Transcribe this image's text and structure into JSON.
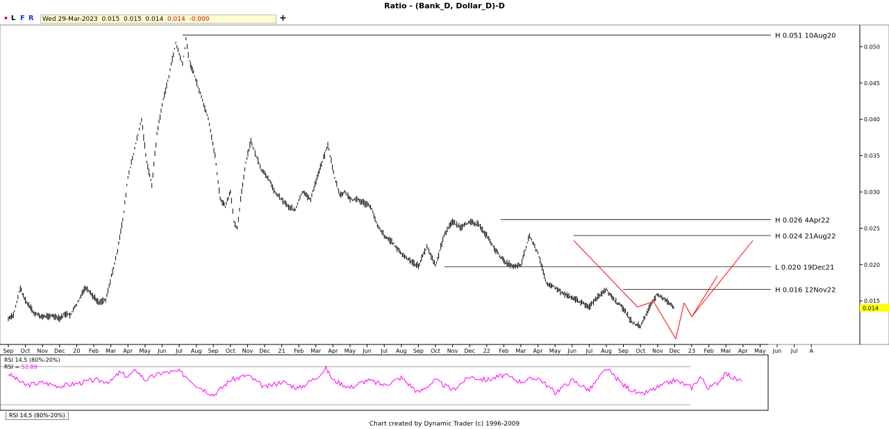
{
  "app": {
    "title": "Ratio - (Bank_D, Dollar_D)-D",
    "footer": "Chart created by Dynamic Trader  (c) 1996-2009",
    "indicator_tab": "RSI 14,5 (80%-20%)"
  },
  "toolbar": {
    "dot": "•",
    "items": [
      "L",
      "F",
      "R"
    ],
    "info_line": "Wed 29-Mar-2023  0.015  0.015  0.014  0.014  -0.000",
    "info_main": "Wed 29-Mar-2023  0.015  0.015  0.014  ",
    "info_close": "0.014  -0.000",
    "plus": "+"
  },
  "colors": {
    "price": "#000000",
    "pattern": "#ff0000",
    "rsi": "#ff00ff",
    "last_price_box": "#ffff00"
  },
  "chart_data": [
    {
      "type": "line",
      "title": "Ratio - (Bank_D, Dollar_D)-D",
      "ylim": [
        0.009,
        0.053
      ],
      "y_ticks": [
        "0.050",
        "0.045",
        "0.040",
        "0.035",
        "0.030",
        "0.025",
        "0.020",
        "0.015",
        "0.014"
      ],
      "x_ticks": [
        "Sep",
        "Oct",
        "Nov",
        "Dec",
        "20",
        "Feb",
        "Mar",
        "Apr",
        "May",
        "Jun",
        "Jul",
        "Aug",
        "Sep",
        "Oct",
        "Nov",
        "Dec",
        "21",
        "Feb",
        "Mar",
        "Apr",
        "May",
        "Jun",
        "Jul",
        "Aug",
        "Sep",
        "Oct",
        "Nov",
        "Dec",
        "22",
        "Feb",
        "Mar",
        "Apr",
        "May",
        "Jun",
        "Jul",
        "Aug",
        "Sep",
        "Oct",
        "Nov",
        "Dec",
        "23",
        "Feb",
        "Mar",
        "Apr",
        "May",
        "Jun",
        "Jul",
        "A"
      ],
      "last_price": 0.014,
      "series": [
        {
          "x_month_index": [
            0,
            0.3,
            0.7,
            1.0,
            1.5,
            2.0,
            2.5,
            3.0,
            3.3,
            3.6,
            4.0,
            4.5,
            5.0,
            5.3,
            5.7,
            6.1,
            6.4,
            6.7,
            7.0,
            7.4,
            7.8,
            8.1,
            8.4,
            8.7,
            9.0,
            9.4,
            9.8,
            10.2,
            10.4,
            10.6,
            10.9,
            11.3,
            11.7,
            12.1,
            12.4,
            12.7,
            13.0,
            13.2,
            13.4,
            13.6,
            13.9,
            14.2,
            14.5,
            14.8,
            15.2,
            15.6,
            16.0,
            16.4,
            16.8,
            17.2,
            17.7,
            18.2,
            18.7,
            19.1,
            19.4,
            19.7,
            20.0,
            20.4,
            20.8,
            21.2,
            21.6,
            22.0,
            22.5,
            23.0,
            23.5,
            24.0,
            24.5,
            25.0,
            25.5,
            26.0,
            26.5,
            27.0,
            27.5,
            28.0,
            28.5,
            29.0,
            29.5,
            30.0,
            30.5,
            31.0,
            31.5,
            32.0,
            32.5,
            33.0,
            33.5,
            34.0,
            34.5,
            35.0,
            35.5,
            36.0,
            36.5,
            37.0,
            37.5,
            38.0,
            38.5,
            39.0,
            39.4,
            39.8,
            40.2,
            40.5,
            40.9,
            41.3,
            41.6,
            41.9,
            42.1,
            42.4,
            42.8
          ],
          "values": [
            0.0125,
            0.013,
            0.0168,
            0.015,
            0.0133,
            0.0128,
            0.013,
            0.0125,
            0.0132,
            0.013,
            0.0145,
            0.0168,
            0.0155,
            0.0148,
            0.0152,
            0.019,
            0.022,
            0.0262,
            0.032,
            0.036,
            0.04,
            0.034,
            0.031,
            0.038,
            0.042,
            0.046,
            0.0505,
            0.0475,
            0.051,
            0.048,
            0.046,
            0.043,
            0.04,
            0.035,
            0.029,
            0.028,
            0.03,
            0.026,
            0.025,
            0.029,
            0.034,
            0.037,
            0.035,
            0.033,
            0.032,
            0.03,
            0.029,
            0.028,
            0.0275,
            0.03,
            0.029,
            0.033,
            0.0365,
            0.032,
            0.0295,
            0.03,
            0.029,
            0.029,
            0.0285,
            0.028,
            0.0255,
            0.024,
            0.023,
            0.0215,
            0.0205,
            0.0198,
            0.0225,
            0.0198,
            0.024,
            0.026,
            0.025,
            0.026,
            0.0255,
            0.024,
            0.022,
            0.0205,
            0.0198,
            0.02,
            0.024,
            0.0215,
            0.0175,
            0.0168,
            0.016,
            0.0155,
            0.0148,
            0.0142,
            0.0155,
            0.0165,
            0.015,
            0.014,
            0.012,
            0.0115,
            0.014,
            0.016,
            0.015,
            0.014
          ]
        }
      ],
      "annotations": [
        {
          "label": "H 0.051 10Aug20",
          "y": 0.0516
        },
        {
          "label": "H 0.026 4Apr22",
          "y": 0.0262
        },
        {
          "label": "H 0.024 21Aug22",
          "y": 0.024
        },
        {
          "label": "L 0.020 19Dec21",
          "y": 0.0197
        },
        {
          "label": "H 0.016 12Nov22",
          "y": 0.0166
        }
      ]
    },
    {
      "type": "line",
      "ylim": [
        0,
        100
      ],
      "bands": [
        80,
        20
      ],
      "legend": [
        {
          "label": "RSI 14,5 (80%-20%)"
        },
        {
          "label": "RSI = ",
          "value": "52.89"
        }
      ],
      "series": [
        {
          "x_month_index": [
            0,
            1,
            2,
            3,
            4,
            5,
            6,
            6.5,
            7,
            7.5,
            8,
            9,
            10,
            10.5,
            11,
            12,
            13,
            14,
            15,
            16,
            17,
            18,
            18.6,
            19,
            20,
            21,
            22,
            23,
            24,
            25,
            26,
            27,
            28,
            29,
            30,
            31,
            32,
            33,
            34,
            35,
            36,
            37,
            38,
            39,
            40,
            40.5,
            41,
            41.5,
            42,
            42.5,
            43
          ],
          "values": [
            68,
            45,
            50,
            43,
            48,
            55,
            52,
            70,
            62,
            75,
            55,
            70,
            72,
            60,
            45,
            25,
            55,
            65,
            40,
            52,
            38,
            60,
            78,
            55,
            40,
            55,
            45,
            60,
            30,
            55,
            35,
            62,
            55,
            65,
            52,
            60,
            30,
            55,
            35,
            78,
            45,
            25,
            40,
            55,
            40,
            62,
            38,
            50,
            68,
            58,
            52
          ]
        }
      ]
    }
  ]
}
